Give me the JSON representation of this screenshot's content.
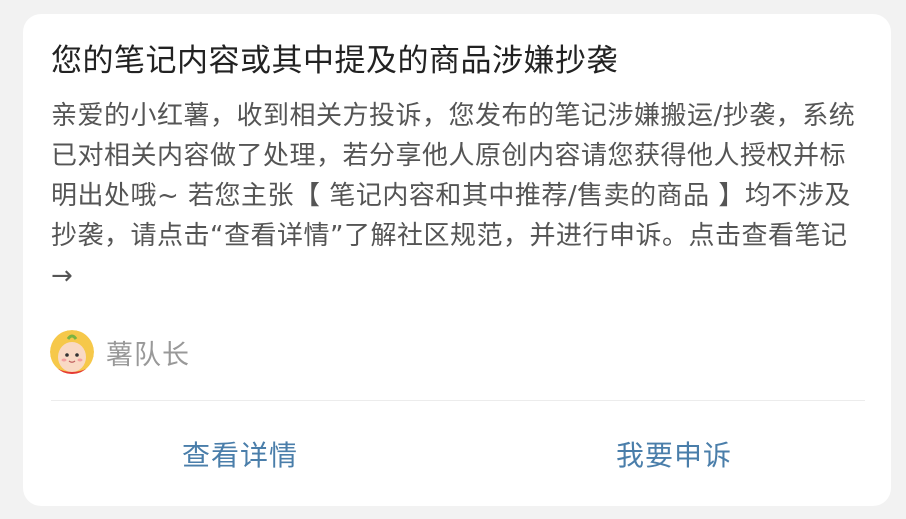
{
  "notice": {
    "title": "您的笔记内容或其中提及的商品涉嫌抄袭",
    "body": "亲爱的小红薯，收到相关方投诉，您发布的笔记涉嫌搬运/抄袭，系统已对相关内容做了处理，若分享他人原创内容请您获得他人授权并标明出处哦~ 若您主张【 笔记内容和其中推荐/售卖的商品 】均不涉及抄袭，请点击“查看详情”了解社区规范，并进行申诉。点击查看笔记→"
  },
  "sender": {
    "name": "薯队长",
    "avatar_icon": "potato-mascot-avatar-icon"
  },
  "actions": {
    "view_details": "查看详情",
    "appeal": "我要申诉"
  },
  "colors": {
    "action": "#4a7eaa",
    "title": "#222222",
    "body": "#555555",
    "sender": "#999999",
    "background": "#f2f2f2",
    "card": "#ffffff"
  }
}
